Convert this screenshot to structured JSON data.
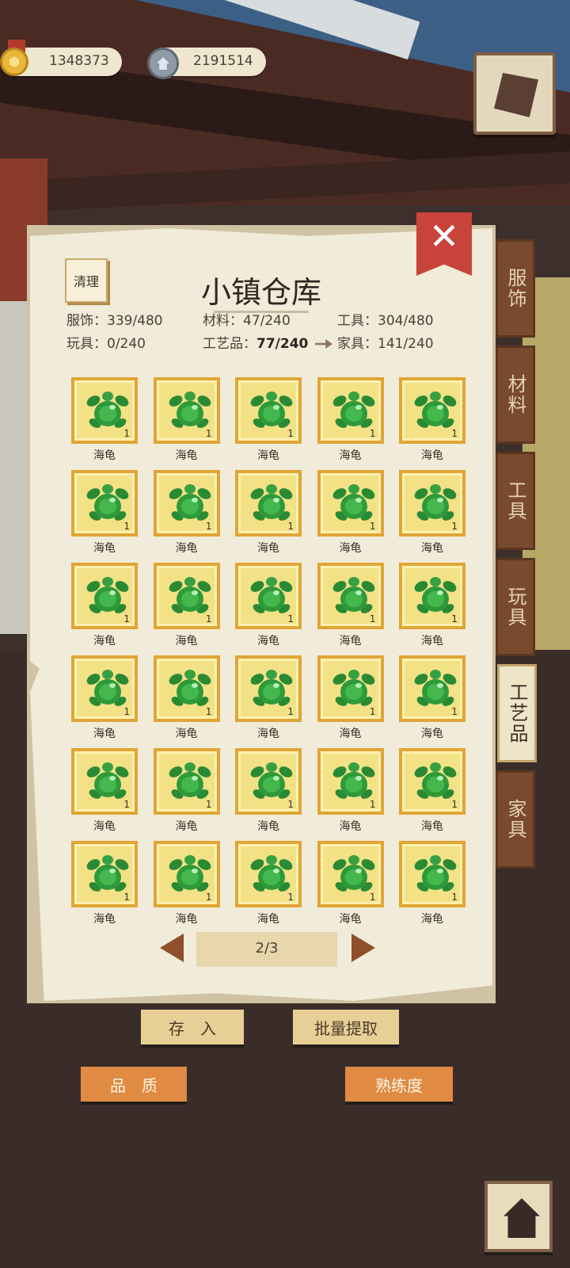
{
  "currency": {
    "gold": "1348373",
    "silver": "2191514"
  },
  "panel": {
    "title": "小镇仓库",
    "clean_label": "清理",
    "close_label": "✕",
    "stats": [
      {
        "label": "服饰：",
        "value": "339/480"
      },
      {
        "label": "材料：",
        "value": "47/240"
      },
      {
        "label": "工具：",
        "value": "304/480"
      },
      {
        "label": "玩具：",
        "value": "0/240"
      },
      {
        "label": "工艺品：",
        "value": "77/240"
      },
      {
        "label": "家具：",
        "value": "141/240"
      }
    ],
    "active_category": "工艺品"
  },
  "items": [
    {
      "name": "海龟",
      "qty": "1"
    },
    {
      "name": "海龟",
      "qty": "1"
    },
    {
      "name": "海龟",
      "qty": "1"
    },
    {
      "name": "海龟",
      "qty": "1"
    },
    {
      "name": "海龟",
      "qty": "1"
    },
    {
      "name": "海龟",
      "qty": "1"
    },
    {
      "name": "海龟",
      "qty": "1"
    },
    {
      "name": "海龟",
      "qty": "1"
    },
    {
      "name": "海龟",
      "qty": "1"
    },
    {
      "name": "海龟",
      "qty": "1"
    },
    {
      "name": "海龟",
      "qty": "1"
    },
    {
      "name": "海龟",
      "qty": "1"
    },
    {
      "name": "海龟",
      "qty": "1"
    },
    {
      "name": "海龟",
      "qty": "1"
    },
    {
      "name": "海龟",
      "qty": "1"
    },
    {
      "name": "海龟",
      "qty": "1"
    },
    {
      "name": "海龟",
      "qty": "1"
    },
    {
      "name": "海龟",
      "qty": "1"
    },
    {
      "name": "海龟",
      "qty": "1"
    },
    {
      "name": "海龟",
      "qty": "1"
    },
    {
      "name": "海龟",
      "qty": "1"
    },
    {
      "name": "海龟",
      "qty": "1"
    },
    {
      "name": "海龟",
      "qty": "1"
    },
    {
      "name": "海龟",
      "qty": "1"
    },
    {
      "name": "海龟",
      "qty": "1"
    },
    {
      "name": "海龟",
      "qty": "1"
    },
    {
      "name": "海龟",
      "qty": "1"
    },
    {
      "name": "海龟",
      "qty": "1"
    },
    {
      "name": "海龟",
      "qty": "1"
    },
    {
      "name": "海龟",
      "qty": "1"
    }
  ],
  "pager": {
    "text": "2/3"
  },
  "tabs": [
    "服饰",
    "材料",
    "工具",
    "玩具",
    "工艺品",
    "家具"
  ],
  "buttons": {
    "deposit": "存　入",
    "batch_withdraw": "批量提取",
    "quality": "品　质",
    "proficiency": "熟练度"
  },
  "icons": {
    "gold": "gold-coin-icon",
    "silver": "silver-coin-icon",
    "top_right": "leaf-book-icon",
    "home": "home-icon"
  },
  "colors": {
    "slot_bg": "#f3e186",
    "slot_border": "#e0a535",
    "turtle": "#2e9a3a",
    "close": "#c8443a",
    "tab": "#7a4a2e",
    "tab_active": "#eee5c8"
  }
}
